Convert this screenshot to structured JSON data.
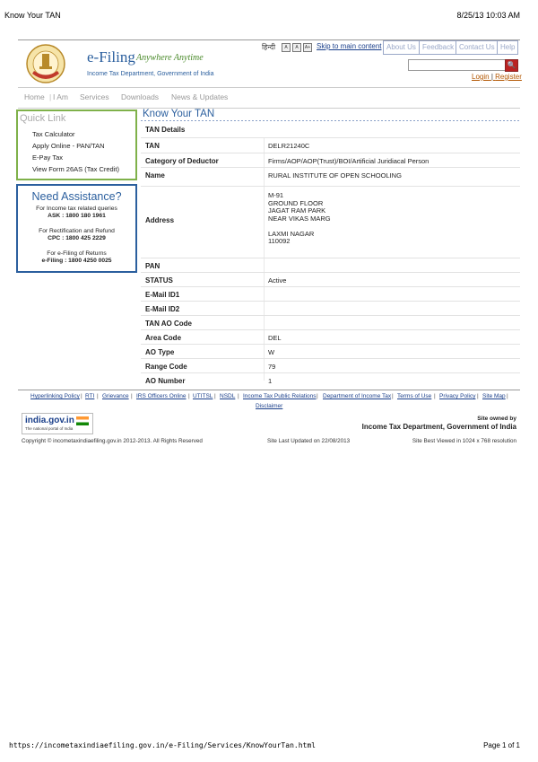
{
  "print_header": {
    "title": "Know Your TAN",
    "datetime": "8/25/13 10:03 AM"
  },
  "print_footer": {
    "url": "https://incometaxindiaefiling.gov.in/e-Filing/Services/KnowYourTan.html",
    "page": "Page 1 of 1"
  },
  "brand": {
    "name": "e-Filing",
    "tagline": "Anywhere Anytime",
    "subtitle": "Income Tax Department, Government of India",
    "emblem_text": "INCOME TAX DEPARTMENT"
  },
  "utility": {
    "hindi": "हिन्दी",
    "font_small": "A",
    "font_normal": "A",
    "font_large": "A+",
    "skip": "Skip to main content"
  },
  "top_tabs": [
    "About Us",
    "Feedback",
    "Contact Us",
    "Help"
  ],
  "search": {
    "placeholder": "",
    "button": "🔍"
  },
  "auth": {
    "login": "Login",
    "separator": "|",
    "register": "Register"
  },
  "nav": [
    "Home",
    "I Am",
    "Services",
    "Downloads",
    "News & Updates"
  ],
  "quick_link": {
    "title": "Quick Link",
    "items": [
      "Tax Calculator",
      "Apply Online - PAN/TAN",
      "E-Pay Tax",
      "View Form 26AS (Tax Credit)"
    ]
  },
  "assistance": {
    "title": "Need Assistance?",
    "l1": "For Income tax related queries",
    "l2": "ASK : 1800 180 1961",
    "l3": "For Rectification and Refund",
    "l4": "CPC : 1800 425 2229",
    "l5": "For e-Filing of Returns",
    "l6": "e-Filing : 1800 4250 0025"
  },
  "main": {
    "title": "Know Your TAN",
    "section": "TAN Details",
    "rows": [
      {
        "label": "TAN",
        "value": "DELR21240C"
      },
      {
        "label": "Category of Deductor",
        "value": "Firms/AOP/AOP(Trust)/BOI/Artificial Juridiacal Person"
      },
      {
        "label": "Name",
        "value": "RURAL INSTITUTE OF OPEN SCHOOLING"
      },
      {
        "label": "Address",
        "address_lines": [
          "M-91",
          "GROUND FLOOR",
          "JAGAT RAM PARK",
          "NEAR VIKAS MARG",
          "",
          "LAXMI NAGAR",
          "110092"
        ]
      },
      {
        "label": "PAN",
        "value": ""
      },
      {
        "label": "STATUS",
        "value": "Active"
      },
      {
        "label": "E-Mail ID1",
        "value": ""
      },
      {
        "label": "E-Mail ID2",
        "value": ""
      },
      {
        "label": "TAN AO Code",
        "value": ""
      },
      {
        "label": "Area Code",
        "value": "DEL"
      },
      {
        "label": "AO Type",
        "value": "W"
      },
      {
        "label": "Range Code",
        "value": "79"
      },
      {
        "label": "AO Number",
        "value": "1"
      }
    ]
  },
  "footer_links": [
    "Hyperlinking Policy",
    "RTI",
    "Grievance",
    "IRS Officers Online",
    "UTITSL",
    "NSDL",
    "Income Tax Public Relations",
    "Department of Income Tax",
    "Terms of Use",
    "Privacy Policy",
    "Site Map",
    "Disclaimer"
  ],
  "india_gov": {
    "name": "india.gov.in",
    "sub": "The national portal of India"
  },
  "owned_by": {
    "label": "Site owned by",
    "org": "Income Tax Department, Government of India"
  },
  "copyright": "Copyright © incometaxindiaefiling.gov.in 2012-2013. All Rights Reserved",
  "last_updated": "Site Last Updated on 22/08/2013",
  "best_viewed": "Site Best Viewed in 1024 x 768 resolution",
  "colors": {
    "brand_blue": "#2b5f9e",
    "quick_green": "#7fb14a",
    "login_orange": "#b25600"
  }
}
